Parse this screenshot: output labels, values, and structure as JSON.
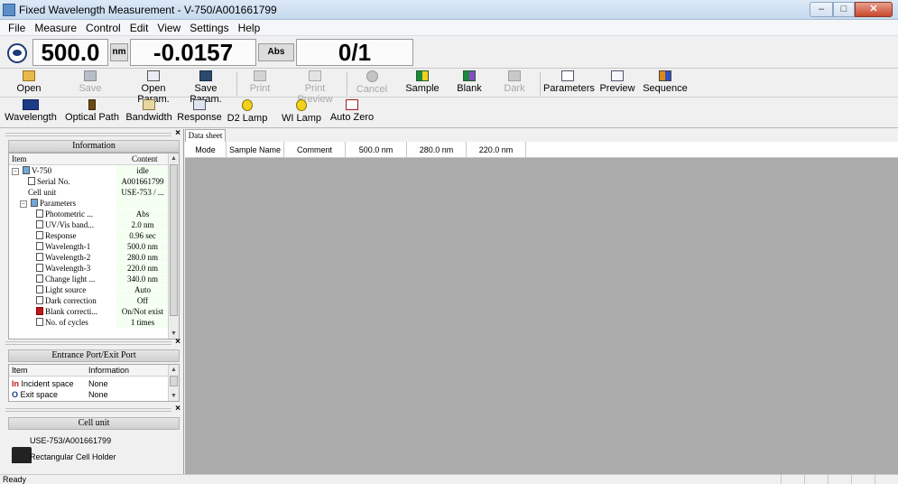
{
  "window": {
    "title": "Fixed Wavelength Measurement - V-750/A001661799"
  },
  "menu": [
    "File",
    "Measure",
    "Control",
    "Edit",
    "View",
    "Settings",
    "Help"
  ],
  "readout": {
    "wavelength": "500.0",
    "wavelength_unit": "nm",
    "value": "-0.0157",
    "value_unit": "Abs",
    "count": "0/1"
  },
  "toolbar1": [
    {
      "label": "Open",
      "icon": "open-folder-icon",
      "enabled": true
    },
    {
      "label": "Save",
      "icon": "save-disk-icon",
      "enabled": false
    },
    {
      "label": "Open Param.",
      "icon": "open-param-icon",
      "enabled": true
    },
    {
      "label": "Save Param.",
      "icon": "save-param-icon",
      "enabled": true
    },
    {
      "label": "Print",
      "icon": "printer-icon",
      "enabled": false
    },
    {
      "label": "Print Preview",
      "icon": "print-preview-icon",
      "enabled": false
    },
    {
      "label": "Cancel",
      "icon": "stop-icon",
      "enabled": false
    },
    {
      "label": "Sample",
      "icon": "sample-icon",
      "enabled": true
    },
    {
      "label": "Blank",
      "icon": "blank-icon",
      "enabled": true
    },
    {
      "label": "Dark",
      "icon": "dark-icon",
      "enabled": false
    },
    {
      "label": "Parameters",
      "icon": "parameters-icon",
      "enabled": true
    },
    {
      "label": "Preview",
      "icon": "preview-icon",
      "enabled": true
    },
    {
      "label": "Sequence",
      "icon": "sequence-icon",
      "enabled": true
    }
  ],
  "toolbar2": [
    {
      "label": "Wavelength",
      "icon": "wavelength-icon"
    },
    {
      "label": "Optical Path",
      "icon": "optical-path-icon"
    },
    {
      "label": "Bandwidth",
      "icon": "bandwidth-icon"
    },
    {
      "label": "Response",
      "icon": "response-icon"
    },
    {
      "label": "D2 Lamp",
      "icon": "d2-lamp-icon"
    },
    {
      "label": "WI Lamp",
      "icon": "wi-lamp-icon"
    },
    {
      "label": "Auto Zero",
      "icon": "auto-zero-icon"
    }
  ],
  "info_panel": {
    "title": "Information",
    "col_item": "Item",
    "col_content": "Content",
    "rows": [
      {
        "name": "V-750",
        "value": "idle",
        "indent": 0,
        "icon": "instrument-icon",
        "expander": "−"
      },
      {
        "name": "Serial No.",
        "value": "A001661799",
        "indent": 2,
        "icon": "serial-icon"
      },
      {
        "name": "Cell unit",
        "value": "USE-753 / ...",
        "indent": 2,
        "icon": ""
      },
      {
        "name": "Parameters",
        "value": "",
        "indent": 1,
        "icon": "parameters-icon",
        "expander": "−"
      },
      {
        "name": "Photometric ...",
        "value": "Abs",
        "indent": 3,
        "icon": "doc-icon"
      },
      {
        "name": "UV/Vis band...",
        "value": "2.0 nm",
        "indent": 3,
        "icon": "doc-icon"
      },
      {
        "name": "Response",
        "value": "0.96 sec",
        "indent": 3,
        "icon": "doc-icon"
      },
      {
        "name": "Wavelength-1",
        "value": "500.0 nm",
        "indent": 3,
        "icon": "doc-icon"
      },
      {
        "name": "Wavelength-2",
        "value": "280.0 nm",
        "indent": 3,
        "icon": "doc-icon"
      },
      {
        "name": "Wavelength-3",
        "value": "220.0 nm",
        "indent": 3,
        "icon": "doc-icon"
      },
      {
        "name": "Change light ...",
        "value": "340.0 nm",
        "indent": 3,
        "icon": "doc-icon"
      },
      {
        "name": "Light source",
        "value": "Auto",
        "indent": 3,
        "icon": "doc-icon"
      },
      {
        "name": "Dark correction",
        "value": "Off",
        "indent": 3,
        "icon": "doc-icon"
      },
      {
        "name": "Blank correcti...",
        "value": "On/Not exist",
        "indent": 3,
        "icon": "red-doc-icon"
      },
      {
        "name": "No. of cycles",
        "value": "1 times",
        "indent": 3,
        "icon": "doc-icon"
      }
    ]
  },
  "port_panel": {
    "title": "Entrance Port/Exit Port",
    "col_item": "Item",
    "col_info": "Information",
    "rows": [
      {
        "name": "Incident space",
        "value": "None",
        "icon": "incident-icon"
      },
      {
        "name": "Exit space",
        "value": "None",
        "icon": "exit-icon"
      }
    ]
  },
  "cell_panel": {
    "title": "Cell unit",
    "model": "USE-753/A001661799",
    "holder": "Rectangular Cell Holder"
  },
  "data_sheet": {
    "tab": "Data sheet",
    "columns": [
      "Mode",
      "Sample Name",
      "Comment",
      "500.0 nm",
      "280.0 nm",
      "220.0 nm"
    ]
  },
  "status": {
    "text": "Ready"
  },
  "colors": {
    "title_bar": "#c7d9ee",
    "data_area": "#ababab",
    "info_value_bg": "#f3fff0",
    "close_button": "#c8482c"
  }
}
